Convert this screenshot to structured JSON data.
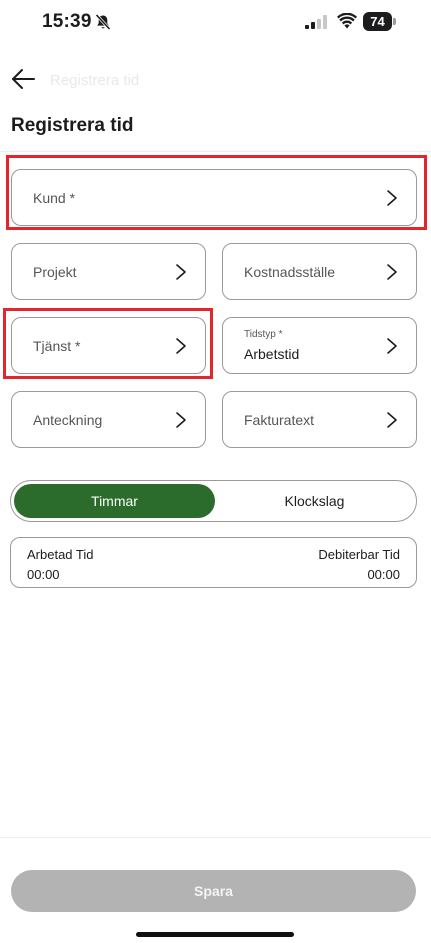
{
  "status_bar": {
    "time": "15:39",
    "battery": "74"
  },
  "nav": {
    "faded_title": "Registrera tid"
  },
  "page_title": "Registrera tid",
  "fields": {
    "kund": {
      "label": "Kund *"
    },
    "projekt": {
      "label": "Projekt"
    },
    "kostnadsstalle": {
      "label": "Kostnadsställe"
    },
    "tjanst": {
      "label": "Tjänst *"
    },
    "tidstyp": {
      "label": "Tidstyp *",
      "value": "Arbetstid"
    },
    "anteckning": {
      "label": "Anteckning"
    },
    "fakturatext": {
      "label": "Fakturatext"
    }
  },
  "segment": {
    "active": "Timmar",
    "inactive": "Klockslag"
  },
  "time_summary": {
    "worked_label": "Arbetad Tid",
    "worked_value": "00:00",
    "billable_label": "Debiterbar Tid",
    "billable_value": "00:00"
  },
  "save_label": "Spara",
  "colors": {
    "accent_green": "#2b6b2b",
    "highlight_red": "#e3262c",
    "disabled_button": "#b3b3b3"
  }
}
